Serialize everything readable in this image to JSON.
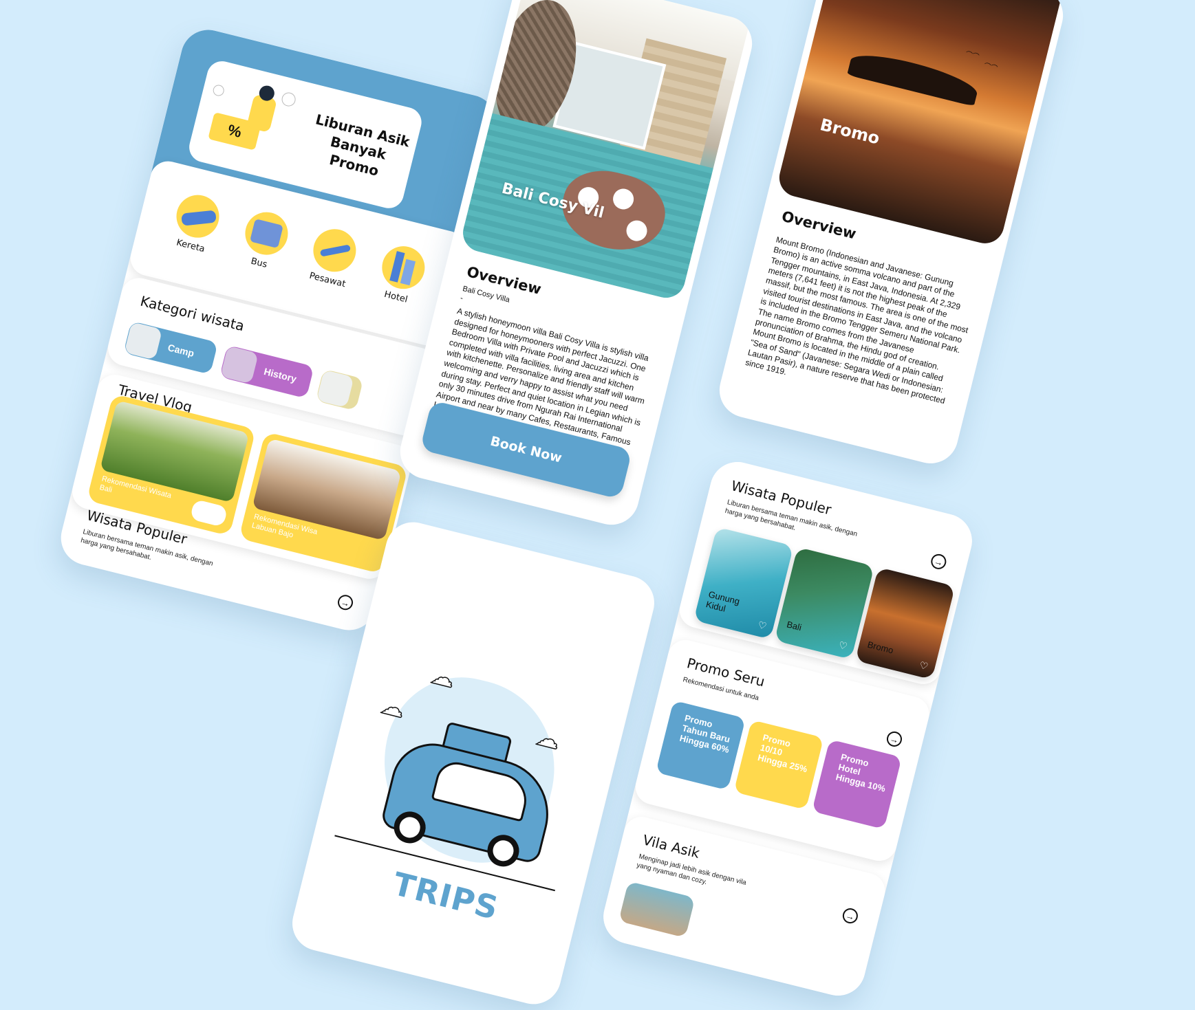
{
  "home": {
    "promo_title_line1": "Liburan Asik",
    "promo_title_line2": "Banyak Promo",
    "transport": [
      {
        "label": "Kereta"
      },
      {
        "label": "Bus"
      },
      {
        "label": "Pesawat"
      },
      {
        "label": "Hotel"
      }
    ],
    "kategori_title": "Kategori wisata",
    "kategori": [
      {
        "label": "Camp",
        "color": "#5ea3ce"
      },
      {
        "label": "History",
        "color": "#b86bc9"
      }
    ],
    "vlog_title": "Travel Vlog",
    "vlogs": [
      {
        "caption_line1": "Rekomendasi Wisata",
        "caption_line2": "Bali"
      },
      {
        "caption_line1": "Rekomendasi Wisa",
        "caption_line2": "Labuan Bajo"
      }
    ],
    "popular_title": "Wisata Populer",
    "popular_sub_line1": "Liburan bersama teman makin asik, dengan",
    "popular_sub_line2": "harga yang bersahabat."
  },
  "bali": {
    "photo_title": "Bali Cosy Vil",
    "overview_title": "Overview",
    "subtitle": "Bali Cosy Villa",
    "dash": "-",
    "description": "A stylish honeymoon villa Bali Cosy Villa is stylish villa designed for honeymooners with perfect Jacuzzi. One Bedroom Villa with Private Pool and Jacuzzi which is completed with villa facilities, living area and kitchen with kitchenette. Personalize and friendly staff will warm welcoming and verry happy to assist what you need during stay. Perfect and quiet location in Legian which is only 30 minutes drive from Ngurah Rai International Airport and near by many Cafes, Restaurants, Famous Legian Beach, Double Six Beach and Potato Head Beach club that make you have perfect holiday in Bali.",
    "book_label": "Book Now"
  },
  "bromo": {
    "photo_title": "Bromo",
    "overview_title": "Overview",
    "description": "Mount Bromo (Indonesian and Javanese: Gunung Bromo) is an active somma volcano and part of the Tengger mountains, in East Java, Indonesia. At 2,329 meters (7,641 feet) it is not the highest peak of the massif, but the most famous. The area is one of the most visited tourist destinations in East Java, and the volcano is included in the Bromo Tengger Semeru National Park. The name Bromo comes from the Javanese pronunciation of Brahma, the Hindu god of creation. Mount Bromo is located in the middle of a plain called \"Sea of Sand\" (Javanese: Segara Wedi or Indonesian: Lautan Pasir), a nature reserve that has been protected since 1919."
  },
  "splash": {
    "brand": "TRIPS"
  },
  "explore": {
    "popular_title": "Wisata Populer",
    "popular_sub_line1": "Liburan bersama teman makin asik, dengan",
    "popular_sub_line2": "harga yang bersahabat.",
    "destinations": [
      {
        "name_line1": "Gunung",
        "name_line2": "Kidul"
      },
      {
        "name_line1": "Bali",
        "name_line2": ""
      },
      {
        "name_line1": "Bromo",
        "name_line2": ""
      }
    ],
    "promo_title": "Promo Seru",
    "promo_sub": "Rekomendasi untuk anda",
    "promos": [
      {
        "line1": "Promo",
        "line2": "Tahun Baru",
        "line3": "Hingga 60%",
        "color": "#5ea3ce"
      },
      {
        "line1": "Promo",
        "line2": "10/10",
        "line3": "Hingga 25%",
        "color": "#ffd94d"
      },
      {
        "line1": "Promo",
        "line2": "Hotel",
        "line3": "Hingga 10%",
        "color": "#b86bc9"
      }
    ],
    "vila_title": "Vila Asik",
    "vila_sub_line1": "Menginap jadi lebih asik dengan vila",
    "vila_sub_line2": "yang nyaman dan cozy."
  },
  "colors": {
    "background": "#d3ecfc",
    "primary": "#5ea3ce",
    "yellow": "#ffd94d",
    "purple": "#b86bc9"
  }
}
